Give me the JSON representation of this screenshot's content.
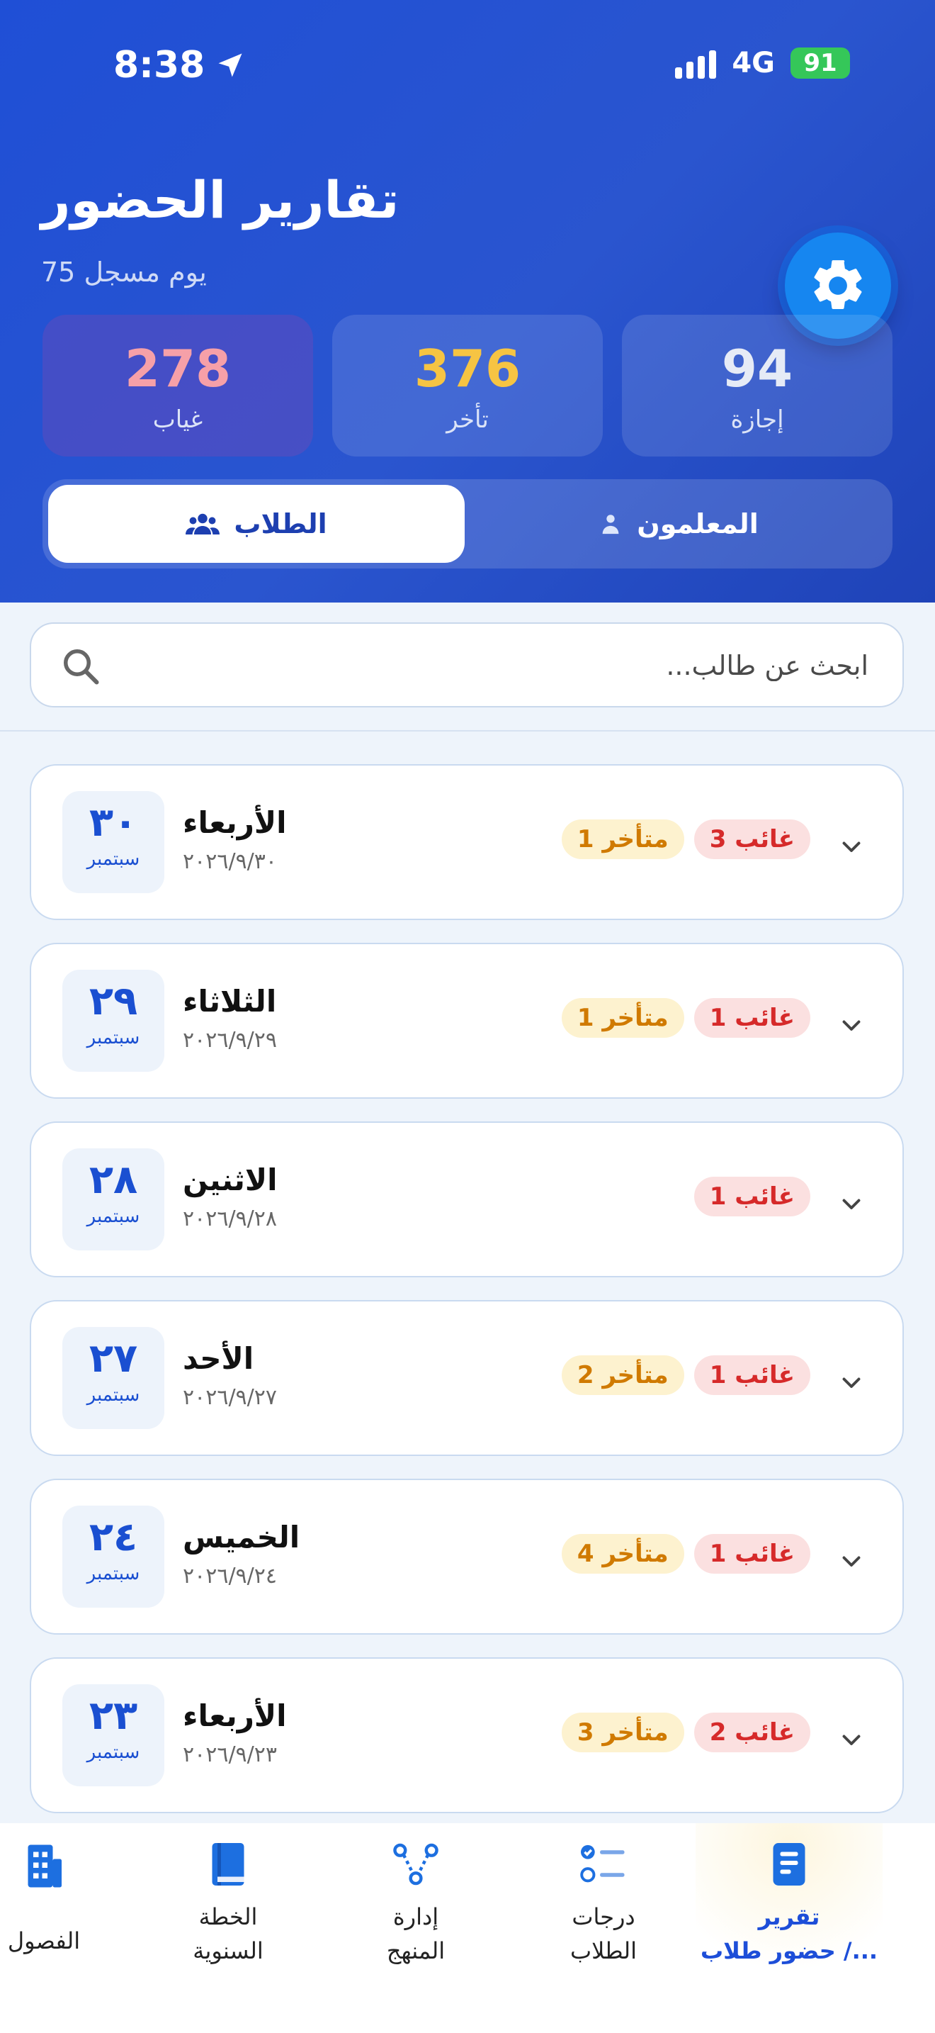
{
  "status_bar": {
    "time": "8:38",
    "network": "4G",
    "battery": "91"
  },
  "header": {
    "title": "تقارير الحضور",
    "subtitle": "75 يوم مسجل"
  },
  "stats": [
    {
      "value": "94",
      "label": "إجازة",
      "color": "#e6ebf6"
    },
    {
      "value": "376",
      "label": "تأخر",
      "color": "#f6c443"
    },
    {
      "value": "278",
      "label": "غياب",
      "color": "#f6a0a8"
    }
  ],
  "tabs": {
    "students": "الطلاب",
    "teachers": "المعلمون",
    "active": "students"
  },
  "search": {
    "placeholder": "ابحث عن طالب..."
  },
  "days": [
    {
      "num": "٣٠",
      "month": "سبتمبر",
      "name": "الأربعاء",
      "date": "٢٠٢٦/٩/٣٠",
      "late": "1 متأخر",
      "absent": "3 غائب"
    },
    {
      "num": "٢٩",
      "month": "سبتمبر",
      "name": "الثلاثاء",
      "date": "٢٠٢٦/٩/٢٩",
      "late": "1 متأخر",
      "absent": "1 غائب"
    },
    {
      "num": "٢٨",
      "month": "سبتمبر",
      "name": "الاثنين",
      "date": "٢٠٢٦/٩/٢٨",
      "late": "",
      "absent": "1 غائب"
    },
    {
      "num": "٢٧",
      "month": "سبتمبر",
      "name": "الأحد",
      "date": "٢٠٢٦/٩/٢٧",
      "late": "2 متأخر",
      "absent": "1 غائب"
    },
    {
      "num": "٢٤",
      "month": "سبتمبر",
      "name": "الخميس",
      "date": "٢٠٢٦/٩/٢٤",
      "late": "4 متأخر",
      "absent": "1 غائب"
    },
    {
      "num": "٢٣",
      "month": "سبتمبر",
      "name": "الأربعاء",
      "date": "٢٠٢٦/٩/٢٣",
      "late": "3 متأخر",
      "absent": "2 غائب"
    }
  ],
  "nav": {
    "classes": "الفصول",
    "annual_plan_1": "الخطة",
    "annual_plan_2": "السنوية",
    "curriculum_1": "إدارة",
    "curriculum_2": "المنهج",
    "grades_1": "درجات",
    "grades_2": "الطلاب",
    "report_1": "تقرير",
    "report_2": "حضور طلاب /...",
    "accent": "#1d4ed8"
  }
}
